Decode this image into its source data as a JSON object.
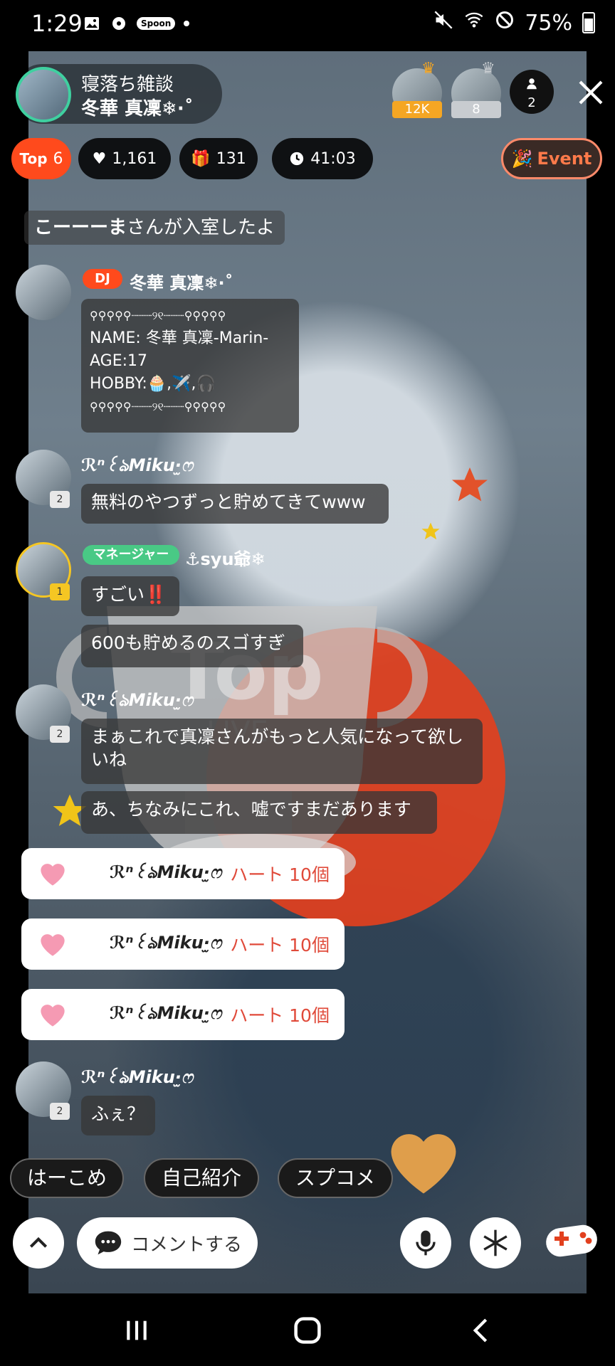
{
  "status_bar": {
    "time": "1:29",
    "spoon_label": "Spoon",
    "battery": "75%"
  },
  "room": {
    "title": "寝落ち雑談",
    "dj_name": "冬華 真凜❄︎·˚",
    "ranking": [
      {
        "label": "12K",
        "color": "#f5a623"
      },
      {
        "label": "8",
        "color": "#c8ccd0"
      }
    ],
    "listener_count": "2"
  },
  "stats": {
    "top_label": "Top",
    "top_value": "6",
    "likes": "1,161",
    "gifts": "131",
    "time": "41:03",
    "event_label": "Event"
  },
  "chat": {
    "system_join": {
      "name": "こーーーま",
      "text": "さんが入室したよ"
    },
    "dj_tag": "DJ",
    "dj_name": "冬華 真凜❄︎·˚",
    "dj_profile": [
      "⚲⚲⚲⚲⚲┈┈┈୨୧┈┈┈⚲⚲⚲⚲⚲",
      "NAME: 冬華 真凜-Marin-",
      "AGE:17",
      "HOBBY:🧁,✈️,🎧",
      "⚲⚲⚲⚲⚲┈┈┈୨୧┈┈┈⚲⚲⚲⚲⚲"
    ],
    "miku_name": "ℛⁿ꒰ঌMiku·̫ෆ",
    "msg1": "無料のやつずっと貯めてきてwww",
    "manager_tag": "マネージャー",
    "syu_name": "⚓︎syu爺❄︎",
    "msg2": "すごい‼️",
    "msg3": "600も貯めるのスゴすぎ",
    "msg4": "まぁこれで真凜さんがもっと人気になって欲しいね",
    "msg5": "あ、ちなみにこれ、嘘ですまだあります",
    "gift_text": "ハート 10個",
    "msg6": "ふぇ？",
    "level_badges": [
      "2",
      "1",
      "2",
      "2"
    ]
  },
  "quick_replies": [
    "はーこめ",
    "自己紹介",
    "スプコメ"
  ],
  "bottom": {
    "comment_label": "コメントする"
  },
  "colors": {
    "accent": "#ff4a1c",
    "manager": "#49c985",
    "gift_text": "#e04a3a"
  }
}
